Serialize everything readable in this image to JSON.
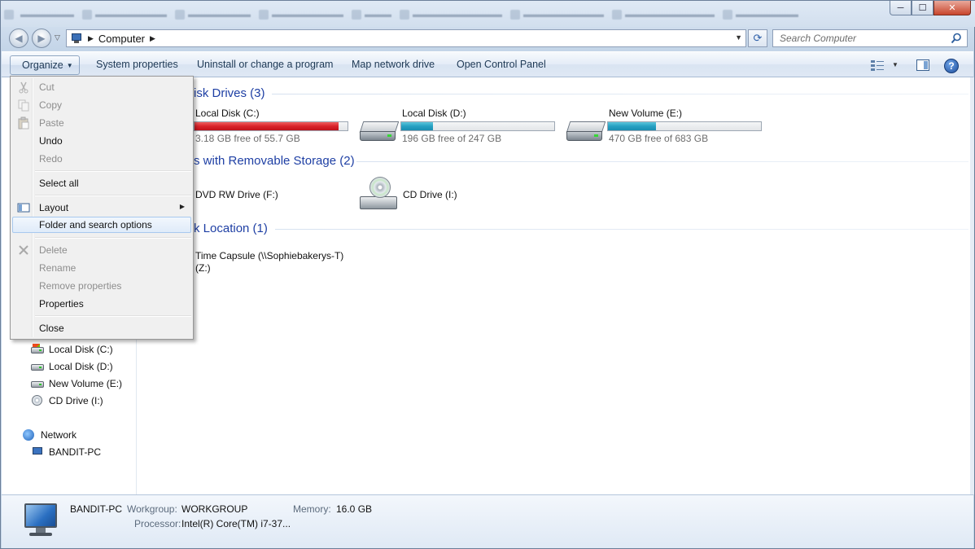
{
  "window": {
    "background_tabs": [
      "",
      "",
      "",
      "",
      "",
      "",
      "",
      "",
      ""
    ],
    "controls": {
      "minimize": "─",
      "maximize": "☐",
      "close": "✕"
    }
  },
  "address": {
    "location": "Computer",
    "search_placeholder": "Search Computer"
  },
  "toolbar": {
    "organize": "Organize",
    "system_properties": "System properties",
    "uninstall": "Uninstall or change a program",
    "map_drive": "Map network drive",
    "control_panel": "Open Control Panel"
  },
  "organize_menu": {
    "cut": "Cut",
    "copy": "Copy",
    "paste": "Paste",
    "undo": "Undo",
    "redo": "Redo",
    "select_all": "Select all",
    "layout": "Layout",
    "folder_options": "Folder and search options",
    "delete": "Delete",
    "rename": "Rename",
    "remove_properties": "Remove properties",
    "properties": "Properties",
    "close": "Close"
  },
  "navpane": {
    "drives": [
      {
        "label": "Local Disk (C:)",
        "icon": "system-drive-icon"
      },
      {
        "label": "Local Disk (D:)",
        "icon": "hard-drive-icon"
      },
      {
        "label": "New Volume (E:)",
        "icon": "hard-drive-icon"
      },
      {
        "label": "CD Drive (I:)",
        "icon": "cd-drive-icon"
      }
    ],
    "network": "Network",
    "computer": "BANDIT-PC"
  },
  "sections": {
    "hard_disks": "isk Drives (3)",
    "removable": "s with Removable Storage (2)",
    "network": "k Location (1)"
  },
  "drives": {
    "c": {
      "name": "Local Disk (C:)",
      "free": "3.18 GB free of 55.7 GB",
      "used_fraction": 0.943,
      "color": "#d9222a"
    },
    "d": {
      "name": "Local Disk (D:)",
      "free": "196 GB free of 247 GB",
      "used_fraction": 0.206,
      "color": "#26a0c2"
    },
    "e": {
      "name": "New Volume (E:)",
      "free": "470 GB free of 683 GB",
      "used_fraction": 0.312,
      "color": "#26a0c2"
    }
  },
  "removable": {
    "dvd": "DVD RW Drive (F:)",
    "cd": "CD Drive (I:)"
  },
  "network_location": {
    "line1": "Time Capsule (\\\\Sophiebakerys-T)",
    "line2": "(Z:)"
  },
  "details": {
    "name": "BANDIT-PC",
    "workgroup_label": "Workgroup:",
    "workgroup": "WORKGROUP",
    "memory_label": "Memory:",
    "memory": "16.0 GB",
    "processor_label": "Processor:",
    "processor": "Intel(R) Core(TM) i7-37..."
  }
}
